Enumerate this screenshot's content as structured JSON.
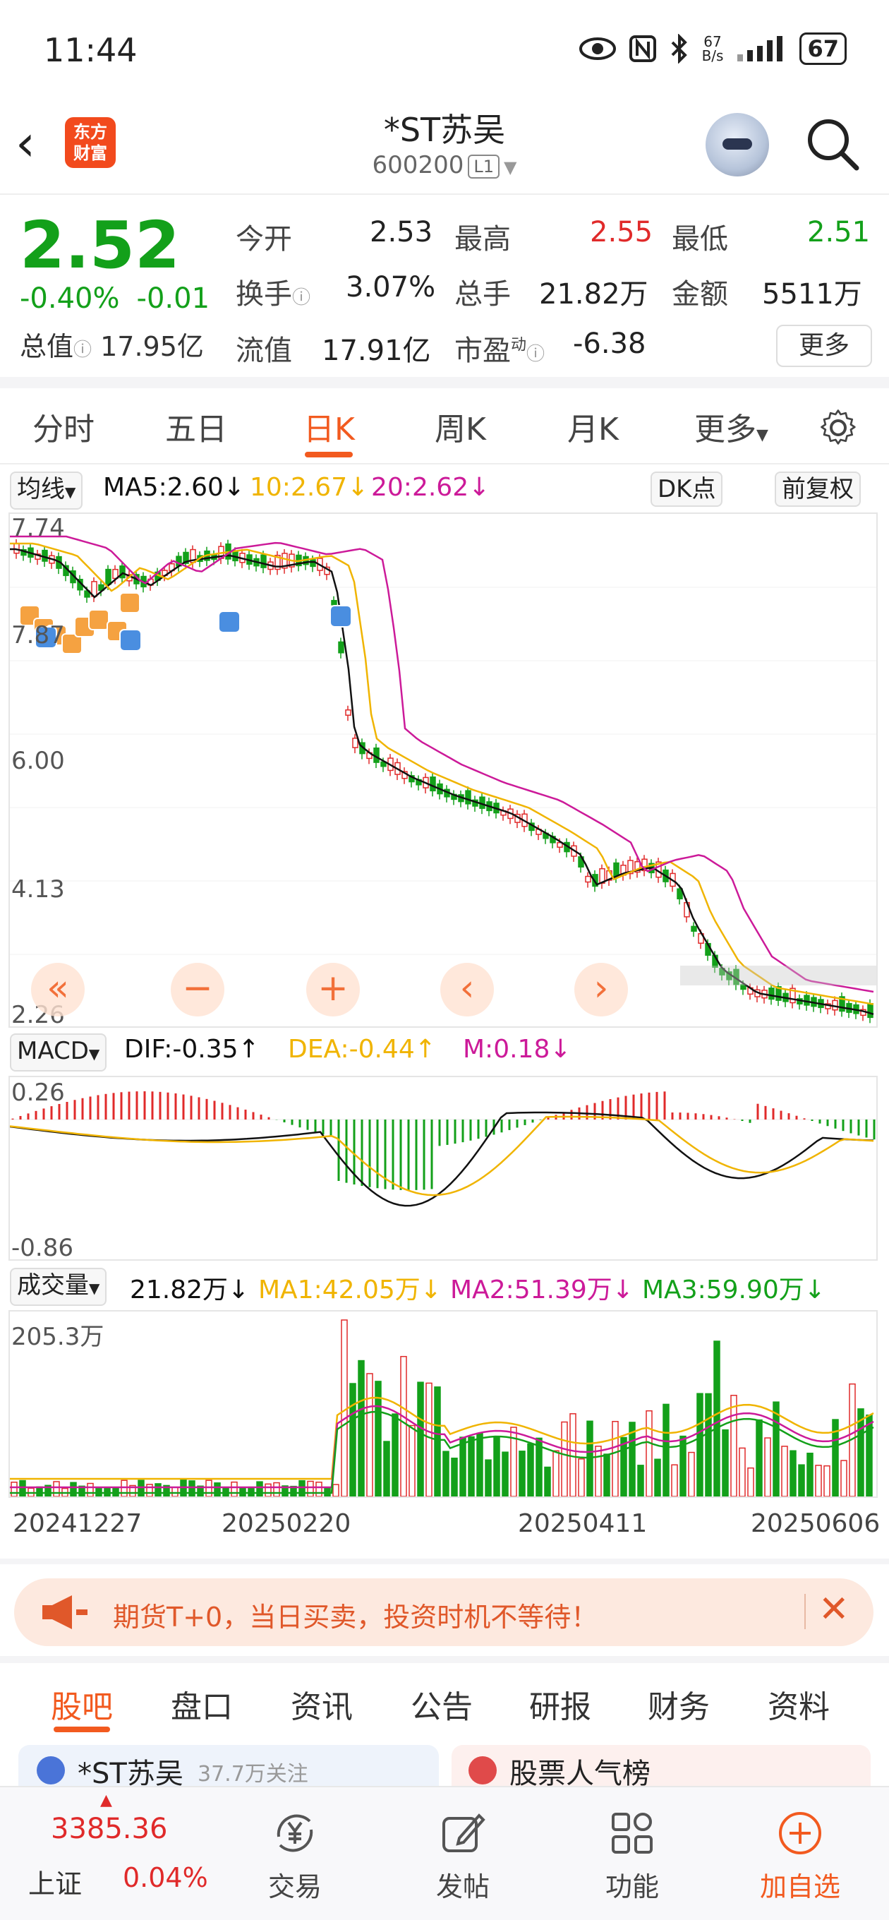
{
  "status_bar": {
    "time": "11:44",
    "net_speed_value": "67",
    "net_speed_unit": "B/s",
    "battery": "67"
  },
  "header": {
    "logo_line1": "东方",
    "logo_line2": "财富",
    "stock_name": "*ST苏吴",
    "stock_code": "600200",
    "level_badge": "L1"
  },
  "quote": {
    "price": "2.52",
    "change_pct": "-0.40%",
    "change_abs": "-0.01",
    "open_label": "今开",
    "open": "2.53",
    "high_label": "最高",
    "high": "2.55",
    "low_label": "最低",
    "low": "2.51",
    "turnover_label": "换手",
    "turnover": "3.07%",
    "volume_label": "总手",
    "volume": "21.82万",
    "amount_label": "金额",
    "amount": "5511万",
    "mktcap_label": "总值",
    "mktcap": "17.95亿",
    "float_label": "流值",
    "float_cap": "17.91亿",
    "pe_label": "市盈",
    "pe_superscript": "动",
    "pe": "-6.38",
    "more_button": "更多"
  },
  "chart_tabs": [
    "分时",
    "五日",
    "日K",
    "周K",
    "月K",
    "更多"
  ],
  "active_chart_tab": "日K",
  "ma_row": {
    "selector": "均线",
    "ma5": "MA5:2.60↓",
    "ma10": "10:2.67↓",
    "ma20": "20:2.62↓",
    "dk_button": "DK点",
    "adjust_button": "前复权"
  },
  "kline": {
    "y_labels": [
      "7.74",
      "7.87",
      "6.00",
      "4.13",
      "2.26"
    ],
    "buy_marker": "T",
    "sell_marker": "S",
    "controls": [
      "«",
      "−",
      "+",
      "‹",
      "›"
    ]
  },
  "macd": {
    "selector": "MACD",
    "dif": "DIF:-0.35↑",
    "dea": "DEA:-0.44↑",
    "m": "M:0.18↓",
    "y_top": "0.26",
    "y_bottom": "-0.86"
  },
  "volume_panel": {
    "selector": "成交量",
    "vol": "21.82万↓",
    "ma1": "MA1:42.05万↓",
    "ma2": "MA2:51.39万↓",
    "ma3": "MA3:59.90万↓",
    "y_top": "205.3万"
  },
  "dates": [
    "20241227",
    "20250220",
    "20250411",
    "20250606"
  ],
  "banner": {
    "text": "期货T+0，当日买卖，投资时机不等待！"
  },
  "bottom_tabs": [
    "股吧",
    "盘口",
    "资讯",
    "公告",
    "研报",
    "财务",
    "资料"
  ],
  "active_bottom_tab": "股吧",
  "peek": {
    "left_text": "*ST苏吴",
    "left_sub": "37.7万关注",
    "right_text": "股票人气榜"
  },
  "navbar": {
    "index_value": "3385.36",
    "index_name": "上证",
    "index_change": "0.04%",
    "items": [
      "交易",
      "发帖",
      "功能",
      "加自选"
    ]
  },
  "colors": {
    "up": "#e02a2a",
    "down": "#13a01a",
    "accent": "#f25a1f",
    "ma5": "#111111",
    "ma10": "#f0b400",
    "ma20": "#cc1a99"
  }
}
